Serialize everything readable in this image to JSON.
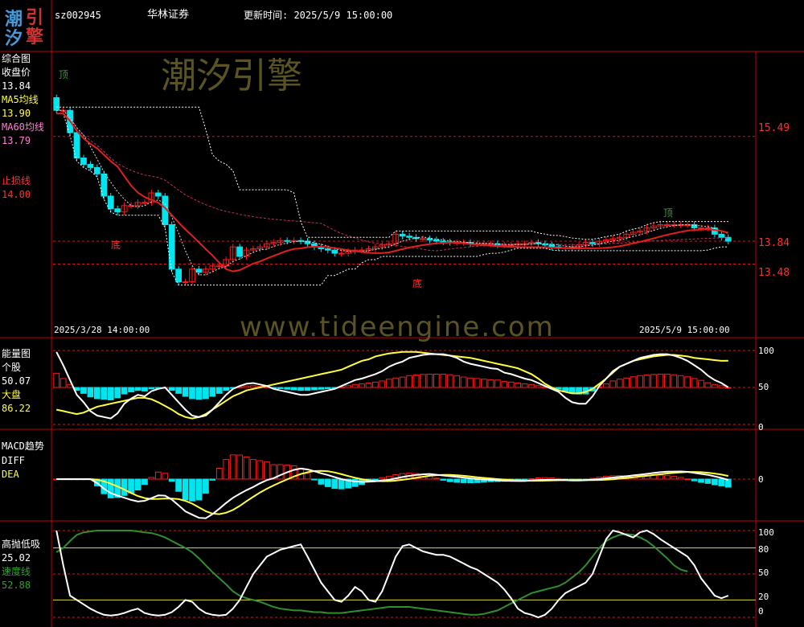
{
  "header": {
    "logo_chars": [
      "潮",
      "引",
      "汐",
      "擎"
    ],
    "stock_code": "sz002945",
    "stock_name": "华林证券",
    "update_label": "更新时间: 2025/5/9 15:00:00"
  },
  "watermarks": {
    "brand": "潮汐引擎",
    "url": "www.tideengine.com"
  },
  "colors": {
    "up": "#ff1a1a",
    "down": "#00e5ee",
    "ma5": "#ffffff",
    "ma60": "#ff3030",
    "stop": "#e02020",
    "yellow": "#ffff40",
    "axis": "#c00000",
    "green": "#2f8f2f"
  },
  "panels": {
    "main": {
      "title": "综合图",
      "close_label": "收盘价",
      "close_value": "13.84",
      "ma5_label": "MA5均线",
      "ma5_value": "13.90",
      "ma60_label": "MA60均线",
      "ma60_value": "13.79",
      "stop_label": "止损线",
      "stop_value": "14.00",
      "right_ticks": [
        "15.49",
        "13.84",
        "13.48"
      ],
      "date_start": "2025/3/28 14:00:00",
      "date_end": "2025/5/9 15:00:00",
      "marks": [
        "顶",
        "底",
        "底",
        "顶"
      ]
    },
    "energy": {
      "title": "能量图",
      "stock_label": "个股",
      "stock_value": "50.07",
      "market_label": "大盘",
      "market_value": "86.22",
      "ticks": [
        "100",
        "50",
        "0"
      ]
    },
    "macd": {
      "title": "MACD趋势",
      "diff_label": "DIFF",
      "dea_label": "DEA",
      "ticks": [
        "0"
      ]
    },
    "kdj": {
      "title": "高抛低吸",
      "value": "25.02",
      "speed_label": "速度线",
      "speed_value": "52.88",
      "ticks": [
        "100",
        "80",
        "50",
        "20",
        "0"
      ]
    }
  },
  "chart_data": {
    "type": "candlestick",
    "x_start": "2025/3/28 14:00:00",
    "x_end": "2025/5/9 15:00:00",
    "n_bars": 100,
    "y_ticks": [
      15.49,
      13.84,
      13.48
    ],
    "close_last": 13.84,
    "series": [
      {
        "name": "收盘价",
        "last": 13.84
      },
      {
        "name": "MA5均线",
        "last": 13.9
      },
      {
        "name": "MA60均线",
        "last": 13.79
      },
      {
        "name": "止损线",
        "last": 14.0
      }
    ],
    "close_values": [
      15.9,
      15.9,
      15.55,
      15.15,
      15.05,
      15.0,
      14.9,
      14.55,
      14.35,
      14.3,
      14.4,
      14.4,
      14.45,
      14.45,
      14.6,
      14.55,
      14.1,
      13.4,
      13.2,
      13.2,
      13.4,
      13.35,
      13.4,
      13.45,
      13.45,
      13.55,
      13.75,
      13.6,
      13.7,
      13.72,
      13.75,
      13.8,
      13.82,
      13.85,
      13.84,
      13.85,
      13.84,
      13.8,
      13.75,
      13.72,
      13.7,
      13.65,
      13.65,
      13.68,
      13.7,
      13.7,
      13.72,
      13.75,
      13.78,
      13.8,
      13.95,
      13.92,
      13.9,
      13.88,
      13.88,
      13.86,
      13.84,
      13.83,
      13.82,
      13.82,
      13.82,
      13.8,
      13.8,
      13.8,
      13.8,
      13.78,
      13.78,
      13.78,
      13.8,
      13.8,
      13.82,
      13.8,
      13.78,
      13.75,
      13.74,
      13.74,
      13.75,
      13.78,
      13.82,
      13.8,
      13.84,
      13.86,
      13.88,
      13.9,
      13.95,
      13.98,
      14.0,
      14.05,
      14.08,
      14.1,
      14.1,
      14.1,
      14.1,
      14.1,
      14.05,
      14.05,
      14.05,
      13.95,
      13.9,
      13.84
    ],
    "energy": {
      "个股": [
        98,
        80,
        60,
        40,
        30,
        18,
        12,
        10,
        8,
        15,
        28,
        35,
        40,
        38,
        45,
        48,
        50,
        40,
        30,
        20,
        12,
        10,
        12,
        20,
        30,
        40,
        48,
        52,
        55,
        56,
        54,
        52,
        48,
        46,
        44,
        42,
        40,
        40,
        42,
        44,
        46,
        48,
        52,
        56,
        60,
        62,
        65,
        68,
        72,
        78,
        82,
        85,
        90,
        92,
        94,
        95,
        95,
        95,
        93,
        90,
        85,
        82,
        80,
        78,
        76,
        75,
        70,
        68,
        65,
        62,
        60,
        56,
        52,
        48,
        44,
        36,
        30,
        28,
        28,
        38,
        52,
        62,
        72,
        78,
        82,
        86,
        90,
        92,
        94,
        95,
        95,
        93,
        90,
        86,
        80,
        74,
        66,
        60,
        56,
        50.07
      ],
      "大盘": [
        20,
        18,
        16,
        14,
        16,
        20,
        24,
        26,
        28,
        30,
        32,
        34,
        36,
        36,
        34,
        30,
        25,
        20,
        14,
        10,
        8,
        10,
        14,
        20,
        26,
        32,
        38,
        42,
        46,
        48,
        50,
        52,
        54,
        56,
        58,
        60,
        62,
        64,
        66,
        68,
        70,
        72,
        74,
        78,
        82,
        86,
        88,
        92,
        94,
        96,
        97,
        98,
        98,
        98,
        97,
        96,
        95,
        94,
        93,
        92,
        91,
        90,
        88,
        86,
        84,
        82,
        80,
        78,
        76,
        72,
        68,
        62,
        55,
        50,
        46,
        44,
        42,
        42,
        44,
        48,
        55,
        62,
        70,
        78,
        82,
        86,
        88,
        90,
        92,
        93,
        94,
        94,
        93,
        92,
        90,
        89,
        88,
        87,
        86,
        86.22
      ],
      "ticks": [
        100,
        50,
        0
      ]
    },
    "kdj": {
      "高抛低吸": [
        100,
        60,
        25,
        20,
        15,
        10,
        6,
        3,
        2,
        3,
        5,
        8,
        10,
        5,
        3,
        2,
        3,
        6,
        12,
        20,
        18,
        10,
        5,
        3,
        2,
        3,
        10,
        20,
        35,
        50,
        60,
        70,
        74,
        78,
        80,
        82,
        84,
        70,
        55,
        40,
        30,
        20,
        18,
        25,
        35,
        30,
        20,
        18,
        30,
        50,
        70,
        82,
        84,
        80,
        76,
        74,
        72,
        72,
        70,
        66,
        62,
        58,
        55,
        50,
        45,
        40,
        32,
        22,
        10,
        5,
        3,
        0,
        3,
        10,
        20,
        28,
        32,
        36,
        40,
        50,
        70,
        90,
        100,
        98,
        95,
        92,
        98,
        100,
        96,
        90,
        85,
        80,
        75,
        70,
        60,
        45,
        35,
        25,
        22,
        25.02
      ],
      "速度线": [
        75,
        80,
        88,
        95,
        98,
        99,
        100,
        100,
        100,
        100,
        100,
        100,
        99,
        98,
        97,
        95,
        92,
        88,
        84,
        80,
        75,
        68,
        60,
        52,
        45,
        38,
        30,
        25,
        22,
        20,
        18,
        15,
        12,
        10,
        9,
        8,
        8,
        7,
        6,
        6,
        5,
        5,
        5,
        6,
        7,
        8,
        9,
        10,
        11,
        12,
        12,
        12,
        12,
        11,
        10,
        9,
        8,
        7,
        6,
        5,
        4,
        3,
        3,
        4,
        6,
        8,
        12,
        16,
        20,
        24,
        28,
        30,
        32,
        34,
        36,
        40,
        46,
        52,
        60,
        70,
        80,
        88,
        92,
        95,
        96,
        95,
        92,
        88,
        82,
        75,
        68,
        60,
        55,
        52.88
      ],
      "ticks": [
        100,
        80,
        50,
        20,
        0
      ]
    }
  }
}
